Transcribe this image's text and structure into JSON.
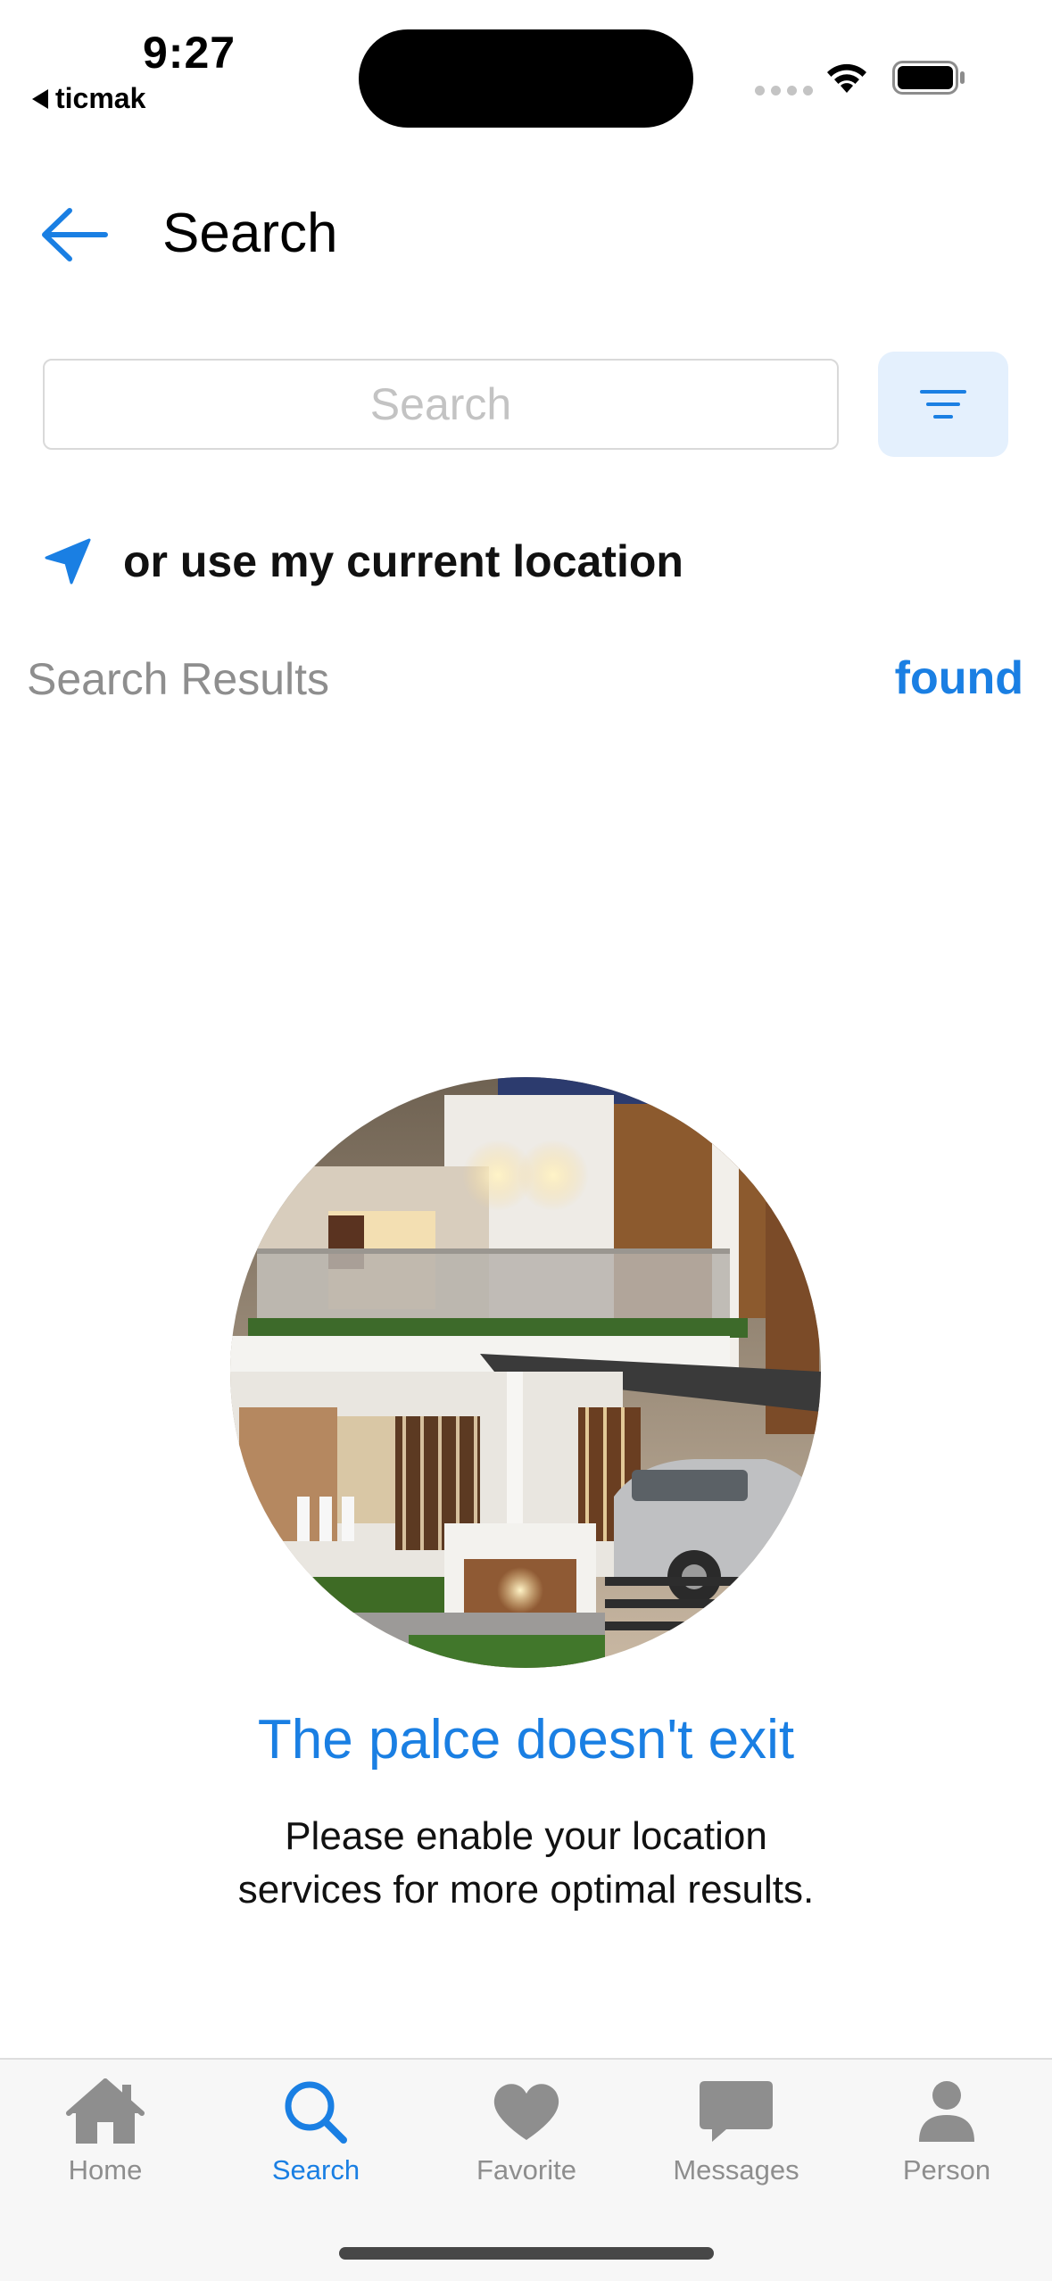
{
  "status_bar": {
    "time": "9:27",
    "back_app": "ticmak"
  },
  "header": {
    "title": "Search",
    "back_icon": "back-arrow-icon"
  },
  "search": {
    "placeholder": "Search",
    "value": "",
    "filter_icon": "filter-icon"
  },
  "location": {
    "label": "or use my current location",
    "icon": "location-arrow-icon"
  },
  "results": {
    "label": "Search Results",
    "count_label": "found"
  },
  "empty_state": {
    "image": "house-photo",
    "title": "The palce doesn't exit",
    "message_line1": "Please enable your location",
    "message_line2": "services for more optimal results."
  },
  "tabs": [
    {
      "label": "Home",
      "icon": "home-icon",
      "active": false
    },
    {
      "label": "Search",
      "icon": "search-icon",
      "active": true
    },
    {
      "label": "Favorite",
      "icon": "heart-icon",
      "active": false
    },
    {
      "label": "Messages",
      "icon": "message-icon",
      "active": false
    },
    {
      "label": "Person",
      "icon": "person-icon",
      "active": false
    }
  ],
  "colors": {
    "accent": "#1a7fe3",
    "muted": "#8e8e8e",
    "filter_bg": "#e4f0fd"
  }
}
